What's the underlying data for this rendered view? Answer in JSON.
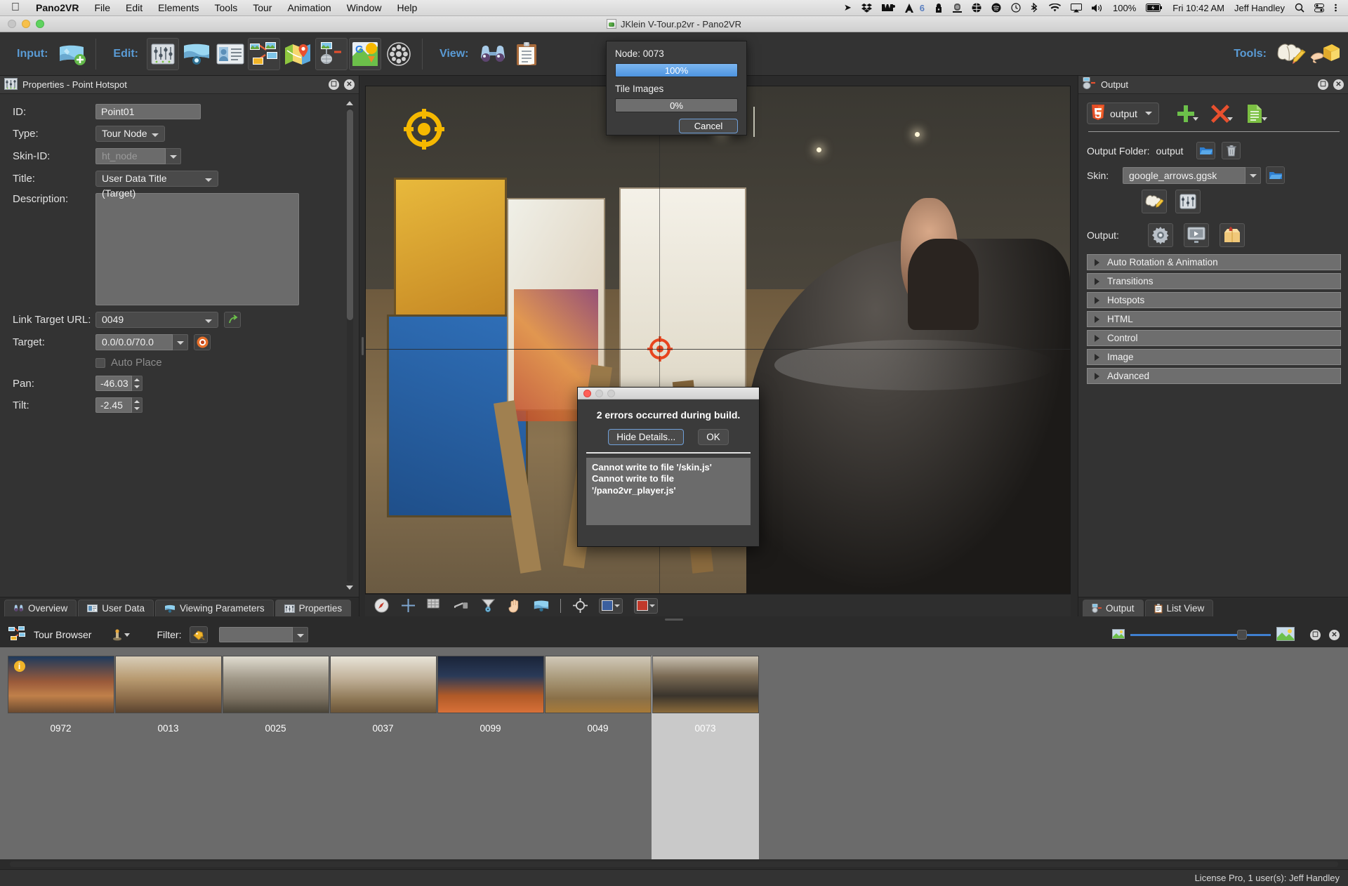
{
  "menubar": {
    "apple_icon": "apple-logo",
    "app_name": "Pano2VR",
    "items": [
      "File",
      "Edit",
      "Elements",
      "Tools",
      "Tour",
      "Animation",
      "Window",
      "Help"
    ],
    "status_icons": [
      "location-arrow-icon",
      "dropbox-icon",
      "we-icon",
      "adobe-icon",
      "lock-icon",
      "camera-icon",
      "basketball-icon",
      "spotify-icon",
      "time-machine-icon",
      "bluetooth-icon",
      "wifi-icon",
      "airplay-icon",
      "volume-icon"
    ],
    "adobe_count": "6",
    "battery_percent": "100%",
    "clock": "Fri 10:42 AM",
    "user": "Jeff Handley",
    "right_icons": [
      "search-icon",
      "control-center-icon",
      "notification-icon"
    ]
  },
  "window": {
    "title": "JKlein V-Tour.p2vr - Pano2VR"
  },
  "toolbar": {
    "input_label": "Input:",
    "edit_label": "Edit:",
    "view_label": "View:",
    "tools_label": "Tools:",
    "input_buttons": [
      "add-panorama-icon"
    ],
    "edit_buttons": [
      "settings-sliders-icon",
      "panorama-viewer-icon",
      "user-data-icon",
      "tour-browser-icon",
      "map-icon",
      "output-icon",
      "google-streetview-icon",
      "film-icon"
    ],
    "view_buttons": [
      "binoculars-icon",
      "clipboard-icon"
    ],
    "tools_buttons": [
      "skin-editor-icon",
      "package-icon"
    ]
  },
  "properties_panel": {
    "title": "Properties - Point Hotspot",
    "icon": "properties-sliders-icon",
    "fields": {
      "id_label": "ID:",
      "id_value": "Point01",
      "type_label": "Type:",
      "type_value": "Tour Node",
      "skin_id_label": "Skin-ID:",
      "skin_id_value": "ht_node",
      "title_label": "Title:",
      "title_value": "User Data Title (Target)",
      "description_label": "Description:",
      "description_value": "",
      "link_target_url_label": "Link Target URL:",
      "link_target_url_value": "0049",
      "target_label": "Target:",
      "target_value": "0.0/0.0/70.0",
      "auto_place_label": "Auto Place",
      "auto_place_checked": false,
      "pan_label": "Pan:",
      "pan_value": "-46.03",
      "tilt_label": "Tilt:",
      "tilt_value": "-2.45"
    },
    "header_buttons": [
      "undock-icon",
      "close-icon"
    ],
    "tabs": [
      {
        "label": "Overview",
        "icon": "binoculars-icon",
        "active": false
      },
      {
        "label": "User Data",
        "icon": "user-data-icon",
        "active": false
      },
      {
        "label": "Viewing Parameters",
        "icon": "viewing-params-icon",
        "active": false
      },
      {
        "label": "Properties",
        "icon": "properties-sliders-icon",
        "active": true
      }
    ]
  },
  "viewer_toolbar": {
    "icons": [
      "compass-icon",
      "crosshair-icon",
      "grid-icon",
      "level-icon",
      "filter-icon",
      "hand-icon",
      "panorama-icon",
      "target-icon"
    ],
    "color_swatch_1": "#3b5f9e",
    "color_swatch_2": "#c0392b"
  },
  "output_panel": {
    "title": "Output",
    "icon": "output-icon",
    "header_buttons": [
      "undock-icon",
      "close-icon"
    ],
    "preset_name": "output",
    "preset_icon": "html5-icon",
    "action_icons": [
      "add-icon",
      "remove-icon",
      "document-icon"
    ],
    "output_folder_label": "Output Folder:",
    "output_folder_value": "output",
    "folder_icons": [
      "folder-icon",
      "trash-icon"
    ],
    "skin_label": "Skin:",
    "skin_value": "google_arrows.ggsk",
    "skin_browse_icon": "folder-icon",
    "skin_buttons": [
      "skin-editor-icon",
      "skin-config-icon"
    ],
    "output_label": "Output:",
    "output_buttons": [
      "gear-icon",
      "preview-icon",
      "package-icon"
    ],
    "sections": [
      "Auto Rotation & Animation",
      "Transitions",
      "Hotspots",
      "HTML",
      "Control",
      "Image",
      "Advanced"
    ],
    "tabs": [
      {
        "label": "Output",
        "icon": "output-icon",
        "active": true
      },
      {
        "label": "List View",
        "icon": "list-view-icon",
        "active": false
      }
    ],
    "zoom_slider": {
      "min_icon": "small-image-icon",
      "max_icon": "large-image-icon",
      "value": 78
    }
  },
  "tour_browser": {
    "title": "Tour Browser",
    "icon": "tour-browser-icon",
    "node_icon": "node-pin-icon",
    "filter_label": "Filter:",
    "filter_icon": "tag-icon",
    "filter_value": "",
    "header_buttons": [
      "undock-icon",
      "close-icon"
    ],
    "thumbnails": [
      {
        "label": "0972",
        "selected": false,
        "badge": "i"
      },
      {
        "label": "0013",
        "selected": false,
        "badge": null
      },
      {
        "label": "0025",
        "selected": false,
        "badge": null
      },
      {
        "label": "0037",
        "selected": false,
        "badge": null
      },
      {
        "label": "0099",
        "selected": false,
        "badge": null
      },
      {
        "label": "0049",
        "selected": false,
        "badge": null
      },
      {
        "label": "0073",
        "selected": true,
        "badge": null
      }
    ]
  },
  "progress_dialog": {
    "node_label": "Node: 0073",
    "node_progress_text": "100%",
    "node_progress_value": 100,
    "tile_label": "Tile Images",
    "tile_progress_text": "0%",
    "tile_progress_value": 0,
    "cancel_label": "Cancel"
  },
  "error_dialog": {
    "message": "2 errors occurred during build.",
    "hide_details_label": "Hide Details...",
    "ok_label": "OK",
    "details": [
      "Cannot write to file '/skin.js'",
      "Cannot write to file '/pano2vr_player.js'"
    ]
  },
  "status_bar": {
    "license": "License Pro, 1 user(s): Jeff Handley"
  },
  "colors": {
    "accent_blue": "#5a9bd5",
    "toolbar_bg": "#333333",
    "panel_bg": "#2b2b2b",
    "progress_blue": "#4d94e0"
  }
}
